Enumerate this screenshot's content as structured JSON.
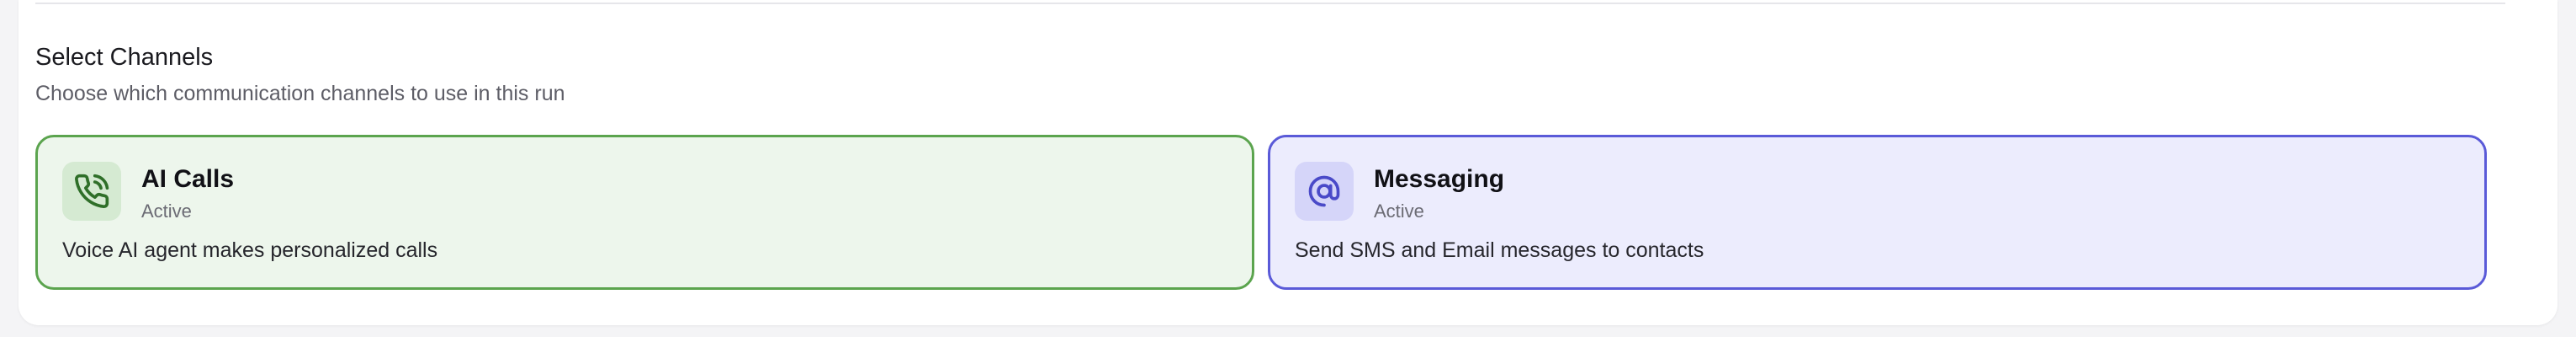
{
  "section": {
    "title": "Select Channels",
    "subtitle": "Choose which communication channels to use in this run"
  },
  "channels": [
    {
      "title": "AI Calls",
      "status": "Active",
      "description": "Voice AI agent makes personalized calls",
      "icon": "phone-call-icon",
      "colors": {
        "border": "#5ba44e",
        "background": "#edf6ec",
        "icon_background": "#d5ead2",
        "icon": "#2f6f29"
      }
    },
    {
      "title": "Messaging",
      "status": "Active",
      "description": "Send SMS and Email messages to contacts",
      "icon": "at-message-icon",
      "colors": {
        "border": "#5a5ad8",
        "background": "#ececfd",
        "icon_background": "#d5d5f9",
        "icon": "#4a4ac8"
      }
    }
  ]
}
